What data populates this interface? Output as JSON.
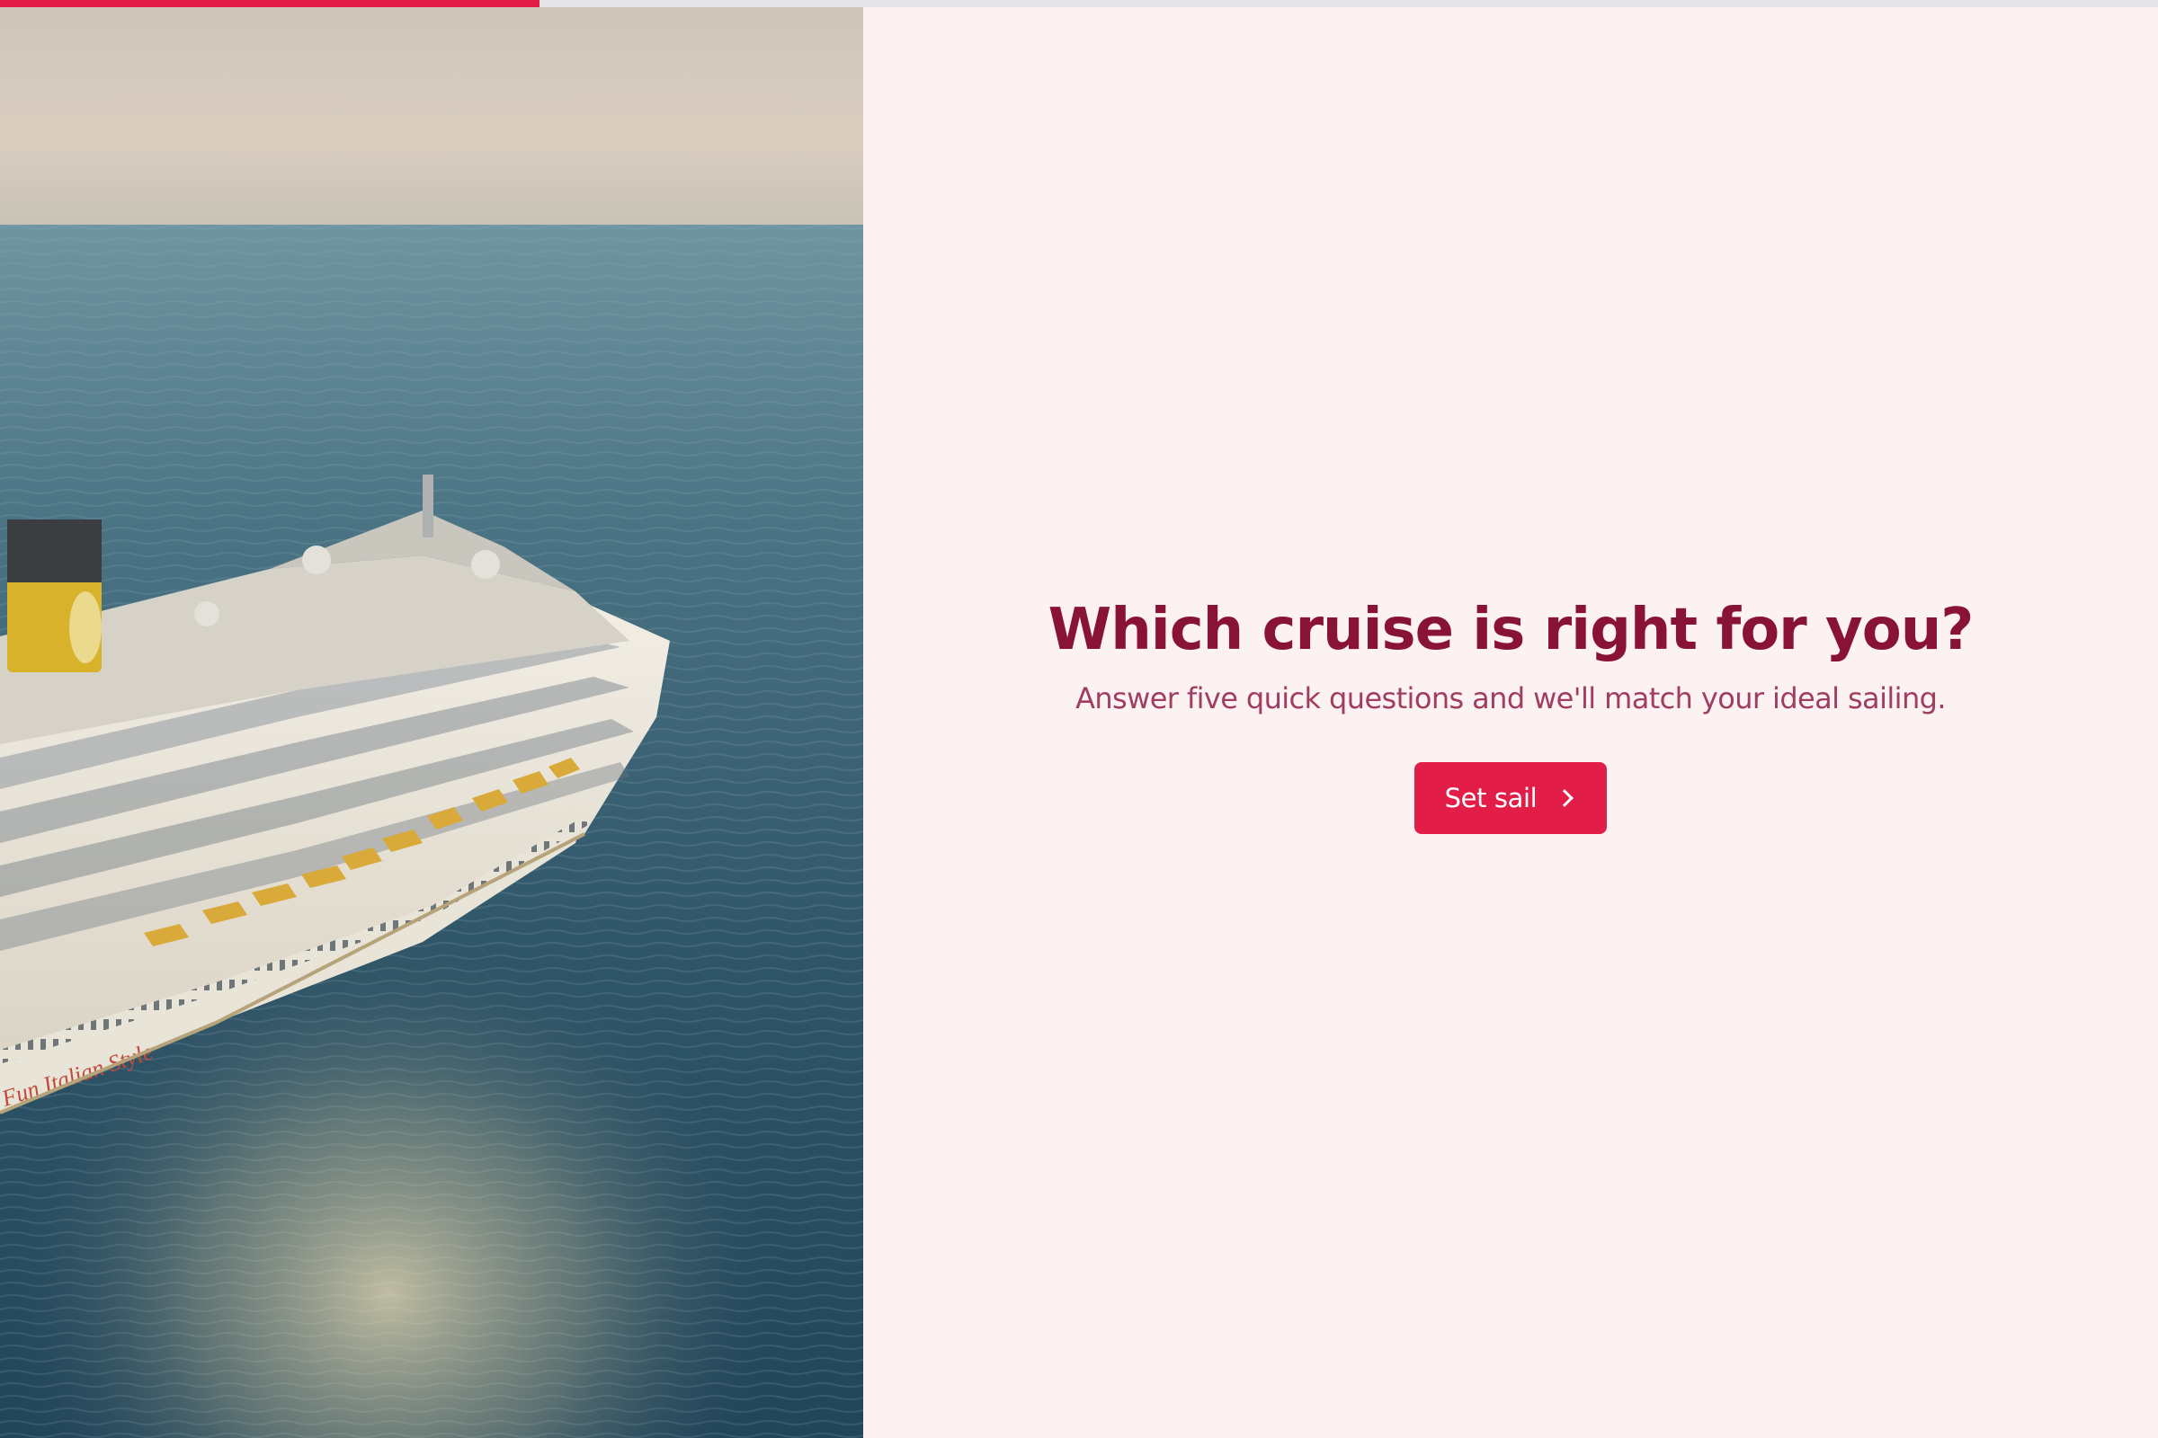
{
  "progress": {
    "fraction": 0.25,
    "color": "#e11d48"
  },
  "hero": {
    "image_subject": "cruise-ship-at-sea",
    "hull_text": "l Fun Italian Style"
  },
  "main": {
    "title": "Which cruise is right for you?",
    "subtitle": "Answer five quick questions and we'll match your ideal sailing.",
    "cta_label": "Set sail",
    "cta_icon": "chevron-right-icon"
  },
  "colors": {
    "background": "#fdf2f2",
    "title": "#881337",
    "subtitle": "#9f3d63",
    "accent": "#e11d48"
  }
}
